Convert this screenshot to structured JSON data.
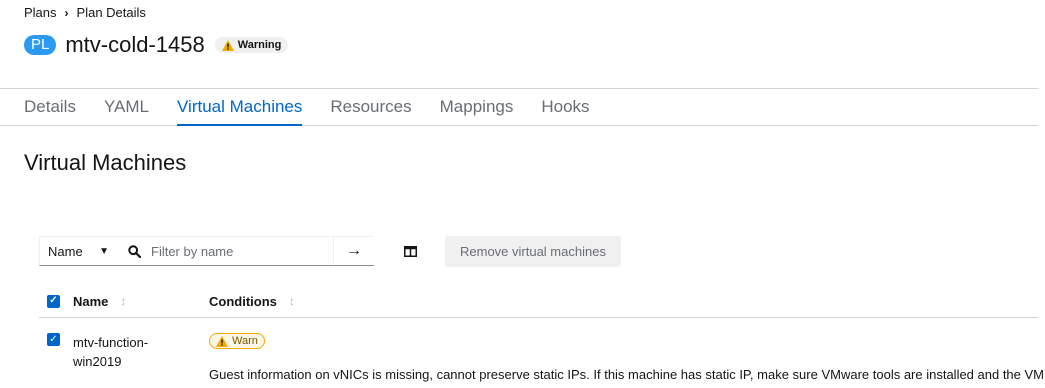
{
  "breadcrumb": {
    "parent": "Plans",
    "current": "Plan Details"
  },
  "header": {
    "kind_badge": "PL",
    "title": "mtv-cold-1458",
    "status": "Warning"
  },
  "tabs": [
    {
      "label": "Details"
    },
    {
      "label": "YAML"
    },
    {
      "label": "Virtual Machines",
      "active": true
    },
    {
      "label": "Resources"
    },
    {
      "label": "Mappings"
    },
    {
      "label": "Hooks"
    }
  ],
  "section": {
    "title": "Virtual Machines"
  },
  "toolbar": {
    "filter_attribute": "Name",
    "search_placeholder": "Filter by name",
    "remove_button": "Remove virtual machines"
  },
  "table": {
    "headers": {
      "name": "Name",
      "conditions": "Conditions"
    },
    "rows": [
      {
        "name": "mtv-function-win2019",
        "condition_label": "Warn",
        "condition_message": "Guest information on vNICs is missing, cannot preserve static IPs. If this machine has static IP, make sure VMware tools are installed and the VM is"
      }
    ]
  },
  "colors": {
    "accent": "#0066cc",
    "warning": "#f0ab00",
    "badge": "#2b9af3"
  }
}
